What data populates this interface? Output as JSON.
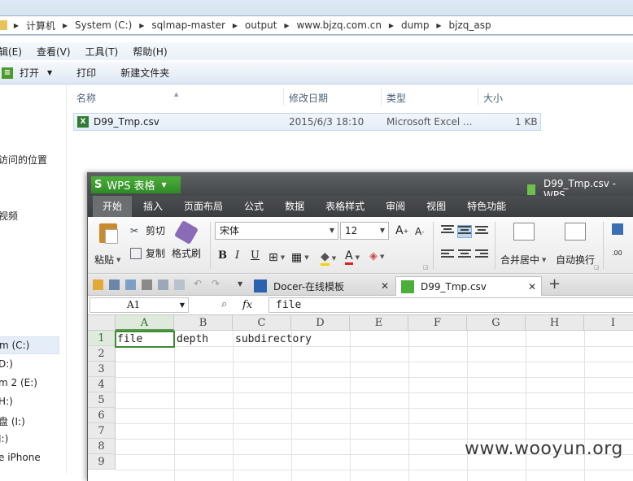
{
  "explorer": {
    "breadcrumb": [
      "计算机",
      "System (C:)",
      "sqlmap-master",
      "output",
      "www.bjzq.com.cn",
      "dump",
      "bjzq_asp"
    ],
    "menu": [
      "辑(E)",
      "查看(V)",
      "工具(T)",
      "帮助(H)"
    ],
    "toolbar": {
      "open": "打开",
      "print": "打印",
      "new_folder": "新建文件夹"
    },
    "nav": [
      "访问的位置",
      "视频",
      "m (C:)",
      "D:)",
      "m 2 (E:)",
      "H:)",
      "盘 (I:)",
      "J:)",
      "e iPhone"
    ],
    "columns": {
      "name": "名称",
      "modified": "修改日期",
      "type": "类型",
      "size": "大小"
    },
    "file": {
      "name": "D99_Tmp.csv",
      "modified": "2015/6/3 18:10",
      "type": "Microsoft Excel ...",
      "size": "1 KB"
    }
  },
  "wps": {
    "brand": "WPS 表格",
    "doc_title": "D99_Tmp.csv - WPS",
    "tabs": [
      "开始",
      "插入",
      "页面布局",
      "公式",
      "数据",
      "表格样式",
      "审阅",
      "视图",
      "特色功能"
    ],
    "active_tab": "开始",
    "ribbon": {
      "paste": "粘贴",
      "cut": "剪切",
      "copy": "复制",
      "format_painter": "格式刷",
      "font": "宋体",
      "font_size": "12",
      "merge_center": "合并居中",
      "wrap": "自动换行"
    },
    "doc_tabs": [
      "Docer-在线模板",
      "D99_Tmp.csv"
    ],
    "formula_bar": {
      "cell_ref": "A1",
      "fx": "fx",
      "value": "file"
    },
    "columns": [
      "A",
      "B",
      "C",
      "D",
      "E",
      "F",
      "G",
      "H",
      "I"
    ],
    "rows": [
      "1",
      "2",
      "3",
      "4",
      "5",
      "6",
      "7",
      "8",
      "9"
    ],
    "row1": [
      "file",
      "depth",
      "subdirectory"
    ]
  },
  "watermark": "www.wooyun.org"
}
